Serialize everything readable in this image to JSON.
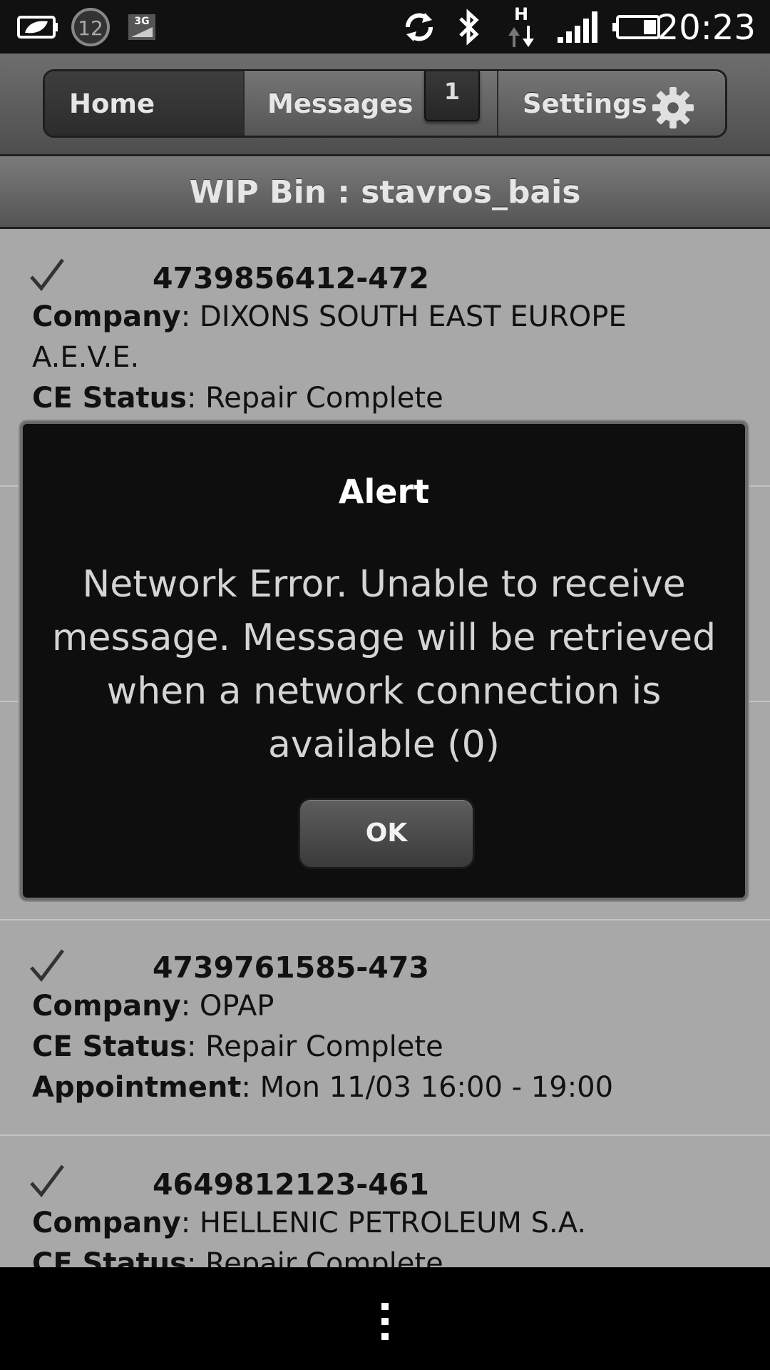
{
  "status_bar": {
    "time": "20:23",
    "notification_count": "12",
    "network_type": "H",
    "icons": [
      "battery-leaf-icon",
      "notification-count-icon",
      "3g-icon",
      "sync-icon",
      "bluetooth-icon",
      "network-arrows-icon",
      "signal-bars-icon",
      "battery-icon"
    ],
    "badge_3g": "3G"
  },
  "nav": {
    "home_label": "Home",
    "messages_label": "Messages",
    "messages_badge": "1",
    "settings_label": "Settings",
    "settings_icon": "gear-icon"
  },
  "header": {
    "title": "WIP Bin : stavros_bais"
  },
  "list": {
    "items": [
      {
        "id": "4739856412-472",
        "company_label": "Company",
        "company": ": DIXONS SOUTH EAST EUROPE A.E.V.E.",
        "status_label": "CE Status",
        "status": ":  Repair Complete"
      },
      {
        "id": "4739761585-473",
        "company_label": "Company",
        "company": ": OPAP",
        "status_label": "CE Status",
        "status": ":  Repair Complete",
        "appointment_label": "Appointment",
        "appointment": ": Mon 11/03 16:00 -  19:00"
      },
      {
        "id": "4649812123-461",
        "company_label": "Company",
        "company": ": HELLENIC PETROLEUM S.A.",
        "status_label": "CE Status",
        "status": ":  Repair Complete"
      }
    ]
  },
  "alert": {
    "title": "Alert",
    "message": "Network Error. Unable to receive message. Message will be retrieved when a network connection is available (0)",
    "ok_label": "OK"
  },
  "bottom_bar": {
    "menu_icon": "overflow-menu-icon"
  }
}
